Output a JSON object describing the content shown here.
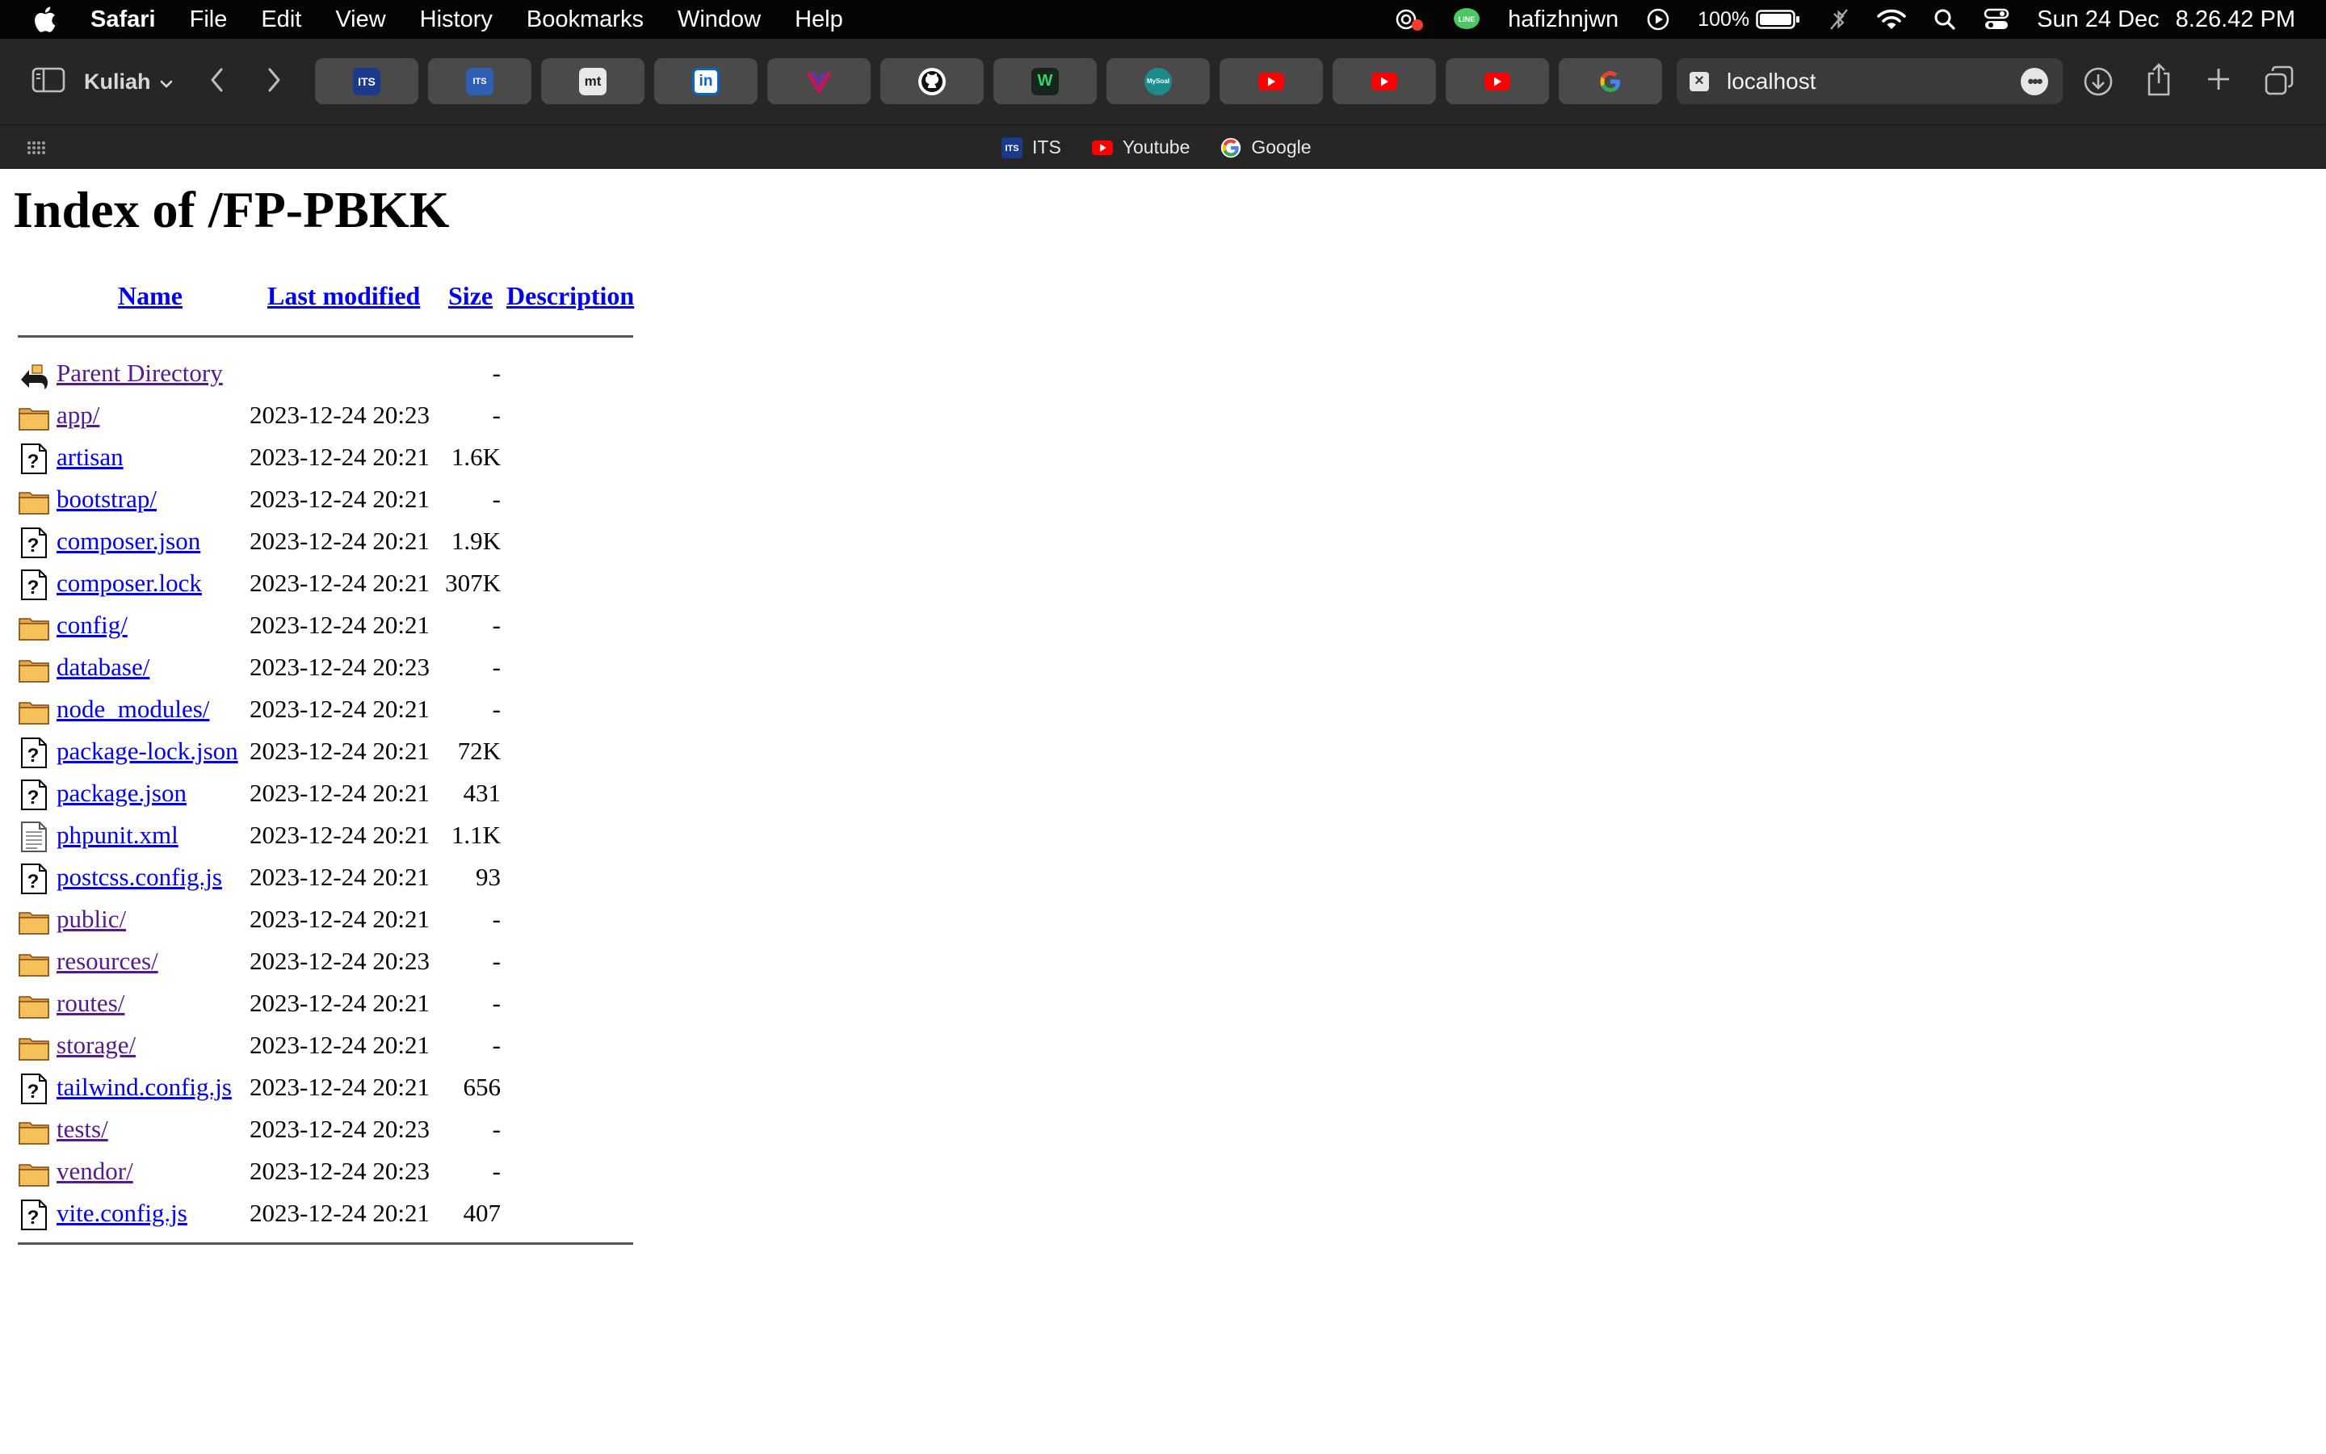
{
  "menubar": {
    "app_name": "Safari",
    "menus": [
      "File",
      "Edit",
      "View",
      "History",
      "Bookmarks",
      "Window",
      "Help"
    ],
    "username": "hafizhnjwn",
    "battery": "100%",
    "date": "Sun 24 Dec",
    "time": "8.26.42 PM"
  },
  "toolbar": {
    "tab_group": "Kuliah",
    "pinned_tabs": [
      {
        "name": "ITS",
        "icon": "its-icon",
        "color": "#1b3a8c"
      },
      {
        "name": "myITS",
        "icon": "myits-icon",
        "color": "#2f5fb3"
      },
      {
        "name": "mt",
        "icon": "mt-icon",
        "color": "#e8e8e8"
      },
      {
        "name": "LinkedIn",
        "icon": "linkedin-icon",
        "color": "#0a66c2"
      },
      {
        "name": "V",
        "icon": "v-logo-icon",
        "color": "#7a2f8f"
      },
      {
        "name": "GitHub",
        "icon": "github-icon",
        "color": "#ffffff"
      },
      {
        "name": "W",
        "icon": "w-logo-icon",
        "color": "#1f7a3c"
      },
      {
        "name": "MySoal",
        "icon": "mysoal-icon",
        "color": "#1a8c8c"
      },
      {
        "name": "YouTube",
        "icon": "youtube-icon",
        "color": "#ff0000"
      },
      {
        "name": "YouTube",
        "icon": "youtube-icon",
        "color": "#ff0000"
      },
      {
        "name": "YouTube",
        "icon": "youtube-icon",
        "color": "#ff0000"
      },
      {
        "name": "Google",
        "icon": "google-icon",
        "color": "#4285f4"
      }
    ],
    "active_tab_title": "localhost"
  },
  "favorites": [
    {
      "label": "ITS",
      "icon": "its-icon"
    },
    {
      "label": "Youtube",
      "icon": "youtube-icon"
    },
    {
      "label": "Google",
      "icon": "google-icon"
    }
  ],
  "page": {
    "title": "Index of /FP-PBKK",
    "headers": {
      "name": "Name",
      "modified": "Last modified",
      "size": "Size",
      "description": "Description"
    },
    "rows": [
      {
        "icon": "parent-directory-icon",
        "name": "Parent Directory",
        "modified": "",
        "size": "-",
        "visited": true
      },
      {
        "icon": "folder-icon",
        "name": "app/",
        "modified": "2023-12-24 20:23",
        "size": "-",
        "visited": true
      },
      {
        "icon": "unknown-file-icon",
        "name": "artisan",
        "modified": "2023-12-24 20:21",
        "size": "1.6K",
        "visited": false
      },
      {
        "icon": "folder-icon",
        "name": "bootstrap/",
        "modified": "2023-12-24 20:21",
        "size": "-",
        "visited": false
      },
      {
        "icon": "unknown-file-icon",
        "name": "composer.json",
        "modified": "2023-12-24 20:21",
        "size": "1.9K",
        "visited": false
      },
      {
        "icon": "unknown-file-icon",
        "name": "composer.lock",
        "modified": "2023-12-24 20:21",
        "size": "307K",
        "visited": false
      },
      {
        "icon": "folder-icon",
        "name": "config/",
        "modified": "2023-12-24 20:21",
        "size": "-",
        "visited": false
      },
      {
        "icon": "folder-icon",
        "name": "database/",
        "modified": "2023-12-24 20:23",
        "size": "-",
        "visited": false
      },
      {
        "icon": "folder-icon",
        "name": "node_modules/",
        "modified": "2023-12-24 20:21",
        "size": "-",
        "visited": false
      },
      {
        "icon": "unknown-file-icon",
        "name": "package-lock.json",
        "modified": "2023-12-24 20:21",
        "size": "72K",
        "visited": false
      },
      {
        "icon": "unknown-file-icon",
        "name": "package.json",
        "modified": "2023-12-24 20:21",
        "size": "431",
        "visited": false
      },
      {
        "icon": "text-file-icon",
        "name": "phpunit.xml",
        "modified": "2023-12-24 20:21",
        "size": "1.1K",
        "visited": false
      },
      {
        "icon": "unknown-file-icon",
        "name": "postcss.config.js",
        "modified": "2023-12-24 20:21",
        "size": "93",
        "visited": false
      },
      {
        "icon": "folder-icon",
        "name": "public/",
        "modified": "2023-12-24 20:21",
        "size": "-",
        "visited": true
      },
      {
        "icon": "folder-icon",
        "name": "resources/",
        "modified": "2023-12-24 20:23",
        "size": "-",
        "visited": true
      },
      {
        "icon": "folder-icon",
        "name": "routes/",
        "modified": "2023-12-24 20:21",
        "size": "-",
        "visited": true
      },
      {
        "icon": "folder-icon",
        "name": "storage/",
        "modified": "2023-12-24 20:21",
        "size": "-",
        "visited": true
      },
      {
        "icon": "unknown-file-icon",
        "name": "tailwind.config.js",
        "modified": "2023-12-24 20:21",
        "size": "656",
        "visited": false
      },
      {
        "icon": "folder-icon",
        "name": "tests/",
        "modified": "2023-12-24 20:23",
        "size": "-",
        "visited": true
      },
      {
        "icon": "folder-icon",
        "name": "vendor/",
        "modified": "2023-12-24 20:23",
        "size": "-",
        "visited": true
      },
      {
        "icon": "unknown-file-icon",
        "name": "vite.config.js",
        "modified": "2023-12-24 20:21",
        "size": "407",
        "visited": false
      }
    ]
  }
}
